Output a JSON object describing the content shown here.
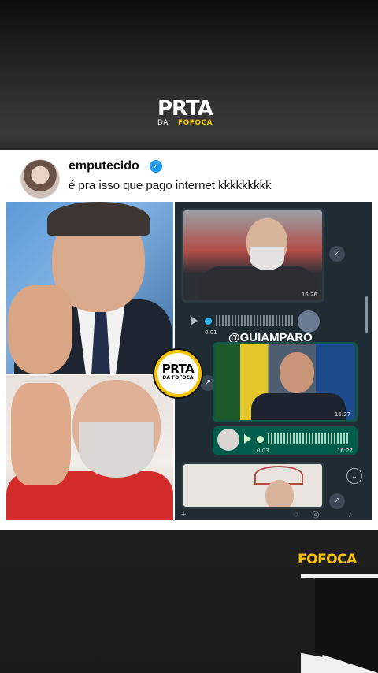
{
  "logo_top": {
    "main": "PRTA",
    "sub_left": "DA",
    "sub_right": "FOFOCA"
  },
  "post": {
    "username": "emputecido",
    "verified_icon": "✓",
    "text": "é pra isso que pago internet kkkkkkkkk"
  },
  "chat": {
    "media_1_time": "16:26",
    "audio_1_duration": "0:01",
    "handle": "@GUIAMPARO",
    "media_2_time": "16:27",
    "audio_2_duration": "0:03",
    "audio_2_time": "16:27",
    "icons": {
      "share": "↗",
      "share_2": "↗",
      "scroll_down": "⌄",
      "share_3": "↗",
      "plus": "+",
      "sticker": "◌",
      "camera": "◎",
      "mic": "♪"
    }
  },
  "logo_mid": {
    "main": "PRTA",
    "sub": "DA FOFOCA"
  },
  "logo_bottom": {
    "word": "FOFOCA"
  },
  "colors": {
    "accent_yellow": "#f5c400",
    "verified_blue": "#1d9bf0",
    "chat_bg": "#1f2c34",
    "outgoing_bubble": "#005c4b"
  }
}
